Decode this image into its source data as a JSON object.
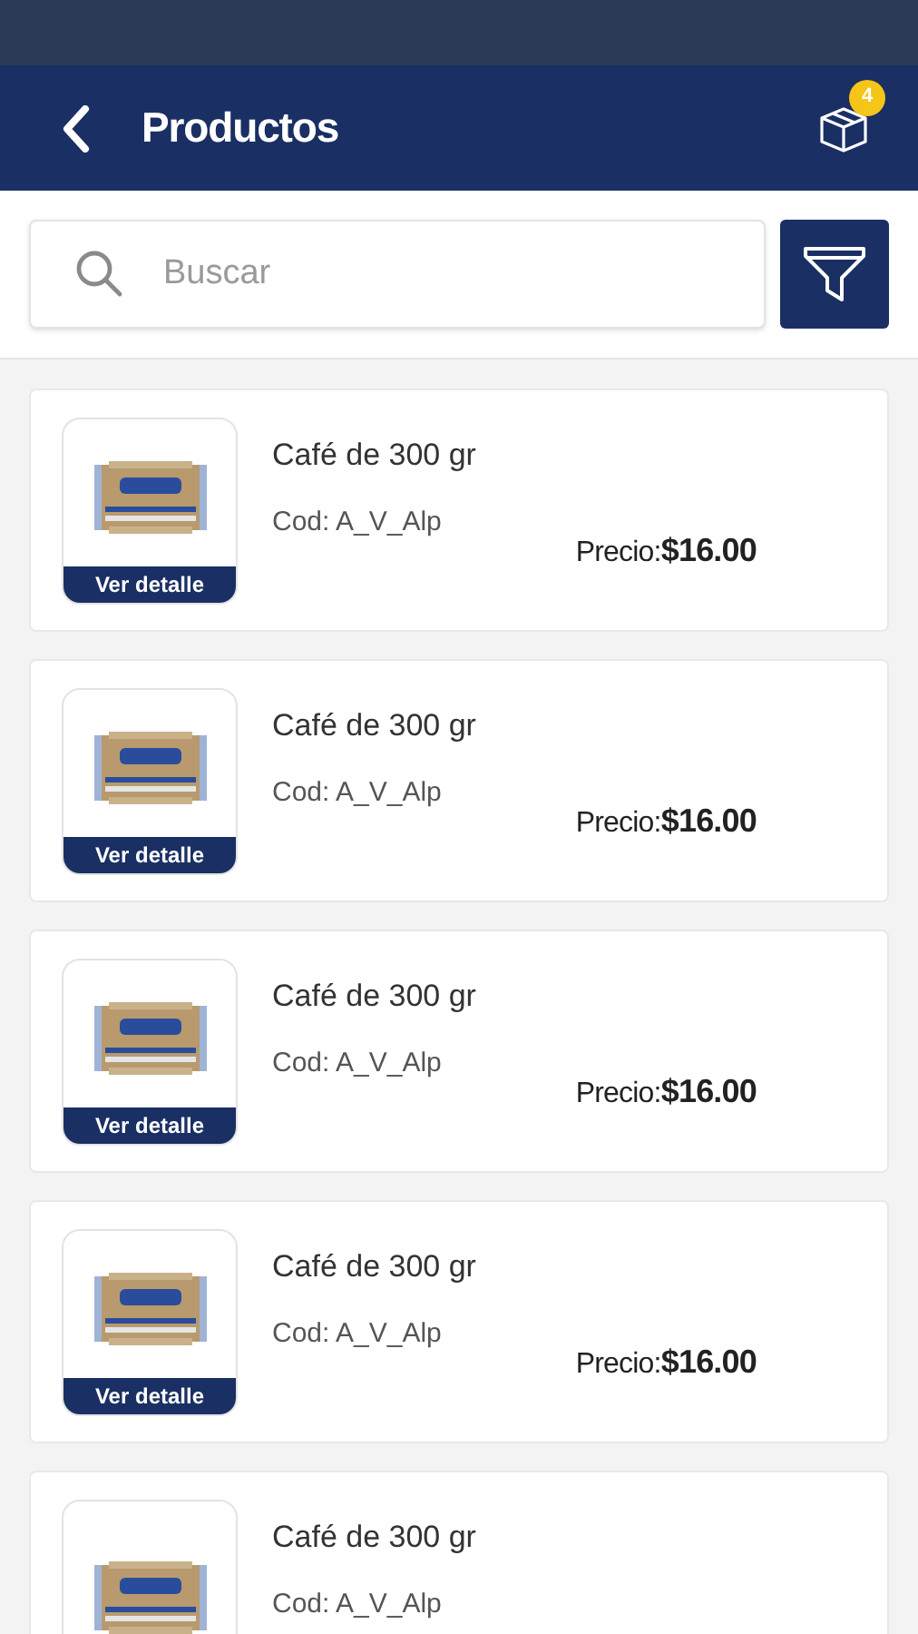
{
  "header": {
    "title": "Productos",
    "cart_count": "4"
  },
  "search": {
    "placeholder": "Buscar"
  },
  "products": [
    {
      "name": "Café de 300 gr",
      "code": "Cod: A_V_Alp",
      "price_label": "Precio:",
      "price": "$16.00",
      "detail_button": "Ver detalle"
    },
    {
      "name": "Café de 300 gr",
      "code": "Cod: A_V_Alp",
      "price_label": "Precio:",
      "price": "$16.00",
      "detail_button": "Ver detalle"
    },
    {
      "name": "Café de 300 gr",
      "code": "Cod: A_V_Alp",
      "price_label": "Precio:",
      "price": "$16.00",
      "detail_button": "Ver detalle"
    },
    {
      "name": "Café de 300 gr",
      "code": "Cod: A_V_Alp",
      "price_label": "Precio:",
      "price": "$16.00",
      "detail_button": "Ver detalle"
    },
    {
      "name": "Café de 300 gr",
      "code": "Cod: A_V_Alp"
    }
  ]
}
